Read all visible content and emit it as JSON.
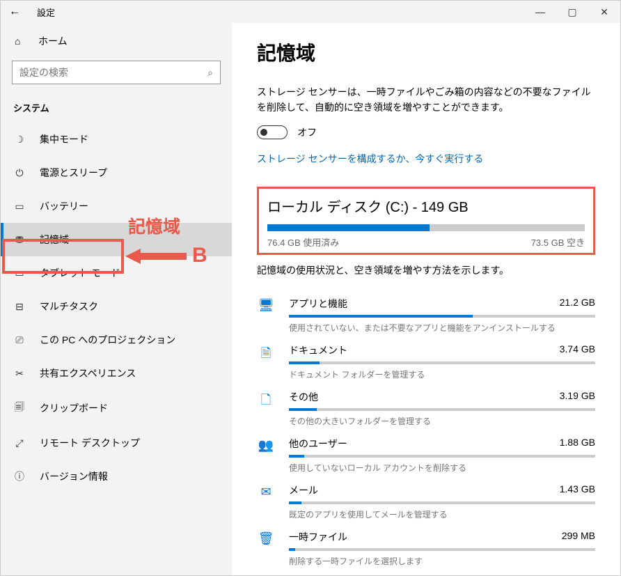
{
  "window": {
    "title": "設定"
  },
  "sidebar": {
    "home": "ホーム",
    "search_placeholder": "設定の検索",
    "section": "システム",
    "items": [
      {
        "label": "集中モード"
      },
      {
        "label": "電源とスリープ"
      },
      {
        "label": "バッテリー"
      },
      {
        "label": "記憶域",
        "selected": true
      },
      {
        "label": "タブレット モード"
      },
      {
        "label": "マルチタスク"
      },
      {
        "label": "この PC へのプロジェクション"
      },
      {
        "label": "共有エクスペリエンス"
      },
      {
        "label": "クリップボード"
      },
      {
        "label": "リモート デスクトップ"
      },
      {
        "label": "バージョン情報"
      }
    ]
  },
  "content": {
    "title": "記憶域",
    "desc": "ストレージ センサーは、一時ファイルやごみ箱の内容などの不要なファイルを削除して、自動的に空き領域を増やすことができます。",
    "toggle_label": "オフ",
    "link": "ストレージ センサーを構成するか、今すぐ実行する",
    "disk": {
      "title": "ローカル ディスク (C:) - 149 GB",
      "used": "76.4 GB 使用済み",
      "free": "73.5 GB 空き"
    },
    "sub_desc": "記憶域の使用状況と、空き領域を増やす方法を示します。",
    "categories": [
      {
        "name": "アプリと機能",
        "size": "21.2 GB",
        "sub": "使用されていない、または不要なアプリと機能をアンインストールする",
        "pct": 60
      },
      {
        "name": "ドキュメント",
        "size": "3.74 GB",
        "sub": "ドキュメント フォルダーを管理する",
        "pct": 10
      },
      {
        "name": "その他",
        "size": "3.19 GB",
        "sub": "その他の大きいフォルダーを管理する",
        "pct": 9
      },
      {
        "name": "他のユーザー",
        "size": "1.88 GB",
        "sub": "使用していないローカル アカウントを削除する",
        "pct": 5
      },
      {
        "name": "メール",
        "size": "1.43 GB",
        "sub": "既定のアプリを使用してメールを管理する",
        "pct": 4
      },
      {
        "name": "一時ファイル",
        "size": "299 MB",
        "sub": "削除する一時ファイルを選択します",
        "pct": 2
      }
    ]
  },
  "annotation": {
    "label": "記憶域",
    "tag": "B"
  }
}
